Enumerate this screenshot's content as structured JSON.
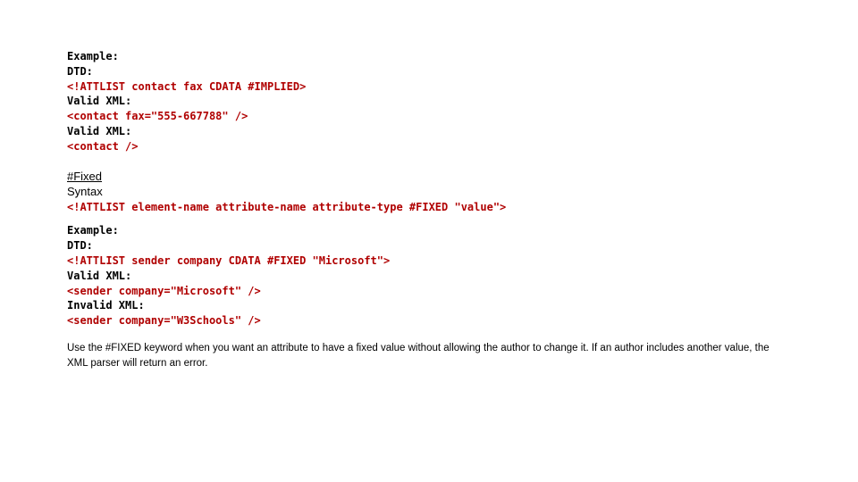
{
  "example1": {
    "label_example": "Example:",
    "label_dtd": "DTD:",
    "dtd_line": "<!ATTLIST contact fax CDATA #IMPLIED>",
    "label_valid1": "Valid XML:",
    "xml_line1": "<contact fax=\"555-667788\" />",
    "label_valid2": "Valid XML:",
    "xml_line2": "<contact />"
  },
  "section2": {
    "heading": "#Fixed",
    "subheading": "Syntax",
    "syntax_line": "<!ATTLIST element-name attribute-name attribute-type #FIXED \"value\">"
  },
  "example2": {
    "label_example": "Example:",
    "label_dtd": "DTD:",
    "dtd_line": "<!ATTLIST sender company CDATA #FIXED \"Microsoft\">",
    "label_valid": "Valid XML:",
    "xml_valid": "<sender company=\"Microsoft\" />",
    "label_invalid": "Invalid XML:",
    "xml_invalid": "<sender company=\"W3Schools\" />"
  },
  "paragraph": "Use the #FIXED keyword when you want an attribute to have a fixed value without allowing the author to change it. If an author includes another value, the XML parser will return an error."
}
